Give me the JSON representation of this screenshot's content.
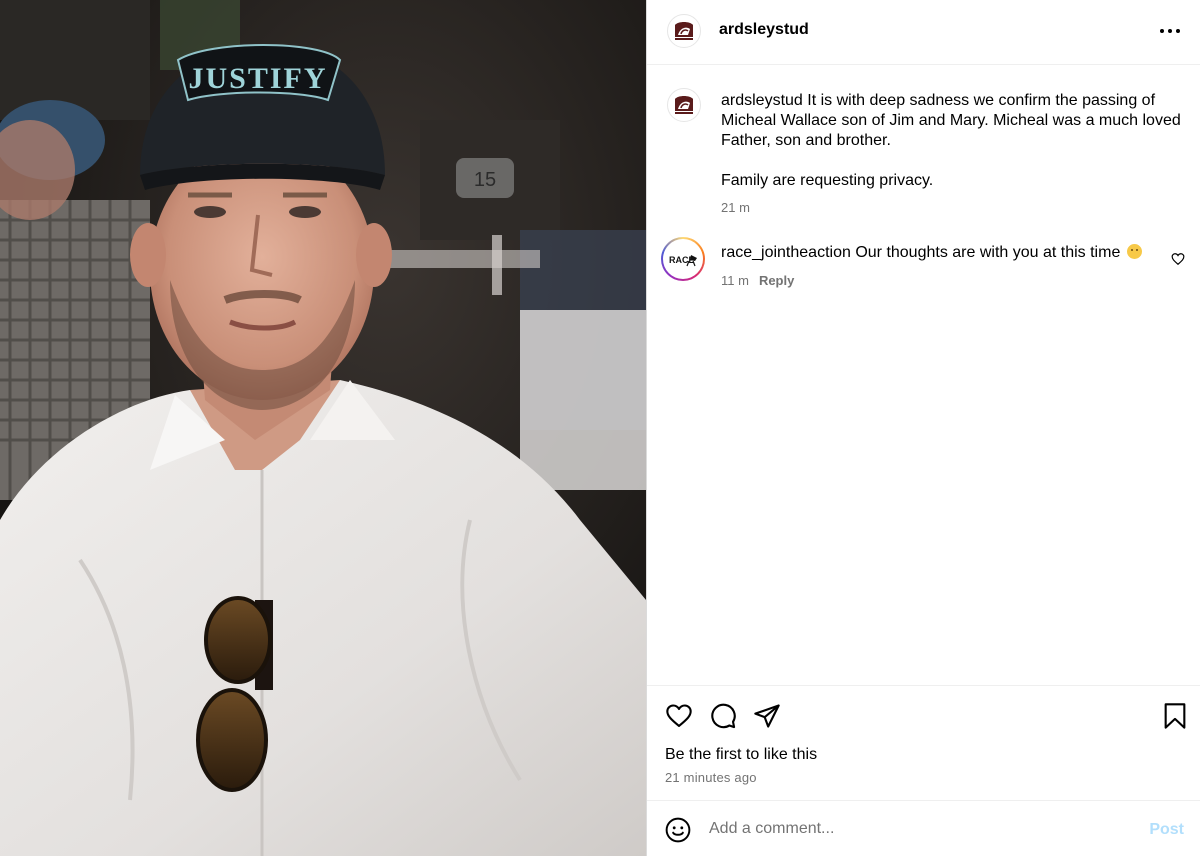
{
  "post": {
    "username": "ardsleystud",
    "avatar_logo_text": "ARDSLEY STUD",
    "caption": {
      "username": "ardsleystud",
      "text_para1": " It is with deep sadness we confirm the passing of Micheal Wallace son of Jim and Mary. Micheal was a much loved Father, son and brother.",
      "text_para2": "Family are requesting privacy.",
      "time": "21 m"
    },
    "photo": {
      "cap_text": "JUSTIFY",
      "table_number": "15"
    }
  },
  "comments": [
    {
      "username": "race_jointheaction",
      "text": " Our thoughts are with you at this time ",
      "emoji": "crying-face-emoji",
      "avatar_logo_text": "RACE",
      "time": "11 m",
      "reply_label": "Reply"
    }
  ],
  "actions": {
    "likes_text": "Be the first to like this",
    "time_ago": "21 minutes ago"
  },
  "comment_box": {
    "placeholder": "Add a comment...",
    "post_label": "Post"
  },
  "colors": {
    "border": "#dbdbdb",
    "secondary_text": "#737373",
    "post_button_disabled": "#b2dffc"
  },
  "icons": [
    "more-icon",
    "heart-icon",
    "comment-icon",
    "share-icon",
    "bookmark-icon",
    "emoji-icon"
  ]
}
